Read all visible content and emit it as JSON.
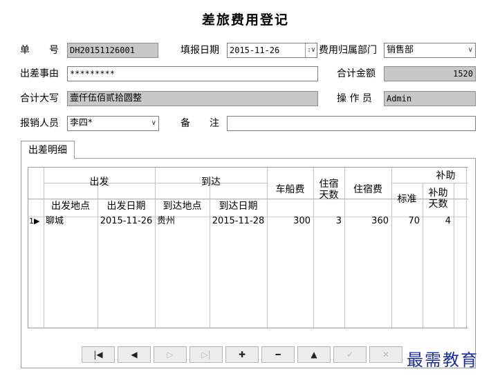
{
  "title": "差旅费用登记",
  "form": {
    "doc_no_label": "单　　号",
    "doc_no": "DH20151126001",
    "fill_date_label": "填报日期",
    "fill_date": "2015-11-26",
    "dept_label": "费用归属部门",
    "dept": "销售部",
    "reason_label": "出差事由",
    "reason": "*********",
    "total_label": "合计金额",
    "total": "1520",
    "total_cn_label": "合计大写",
    "total_cn": "壹仟伍佰贰拾圆整",
    "operator_label": "操 作 员",
    "operator": "Admin",
    "reimburser_label": "报销人员",
    "reimburser": "李四*",
    "remark_label": "备　　注",
    "remark": ""
  },
  "tab_label": "出差明细",
  "grid": {
    "group_headers": {
      "depart": "出发",
      "arrive": "到达",
      "subsidy": "补助"
    },
    "headers": {
      "depart_place": "出发地点",
      "depart_date": "出发日期",
      "arrive_place": "到达地点",
      "arrive_date": "到达日期",
      "fare": "车船费",
      "stay_days": "住宿天数",
      "lodging": "住宿费",
      "std": "标准",
      "sub_days": "补助天数"
    },
    "rows": [
      {
        "no": "1",
        "depart_place": "聊城",
        "depart_date": "2015-11-26",
        "arrive_place": "贵州",
        "arrive_date": "2015-11-28",
        "fare": "300",
        "stay_days": "3",
        "lodging": "360",
        "std": "70",
        "sub_days": "4"
      }
    ]
  },
  "nav": {
    "first": "|◀",
    "prev": "◀",
    "next": "▷",
    "last": "▷|",
    "add": "✚",
    "del": "━",
    "up": "▲",
    "post": "✓",
    "cancel": "✕"
  },
  "watermark": "最需教育"
}
